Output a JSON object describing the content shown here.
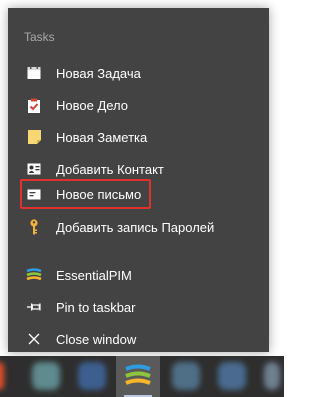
{
  "jumplist": {
    "section_title": "Tasks",
    "tasks": [
      {
        "label": "Новая Задача",
        "icon": "calendar-icon"
      },
      {
        "label": "Новое Дело",
        "icon": "clipboard-check-icon"
      },
      {
        "label": "Новая Заметка",
        "icon": "note-icon"
      },
      {
        "label": "Добавить Контакт",
        "icon": "contact-card-icon"
      },
      {
        "label": "Новое письмо",
        "icon": "email-icon",
        "highlighted": true
      },
      {
        "label": "Добавить запись Паролей",
        "icon": "key-icon"
      }
    ],
    "app_items": [
      {
        "label": "EssentialPIM",
        "icon": "essentialpim-logo-icon"
      },
      {
        "label": "Pin to taskbar",
        "icon": "pin-icon"
      },
      {
        "label": "Close window",
        "icon": "close-icon"
      }
    ]
  },
  "colors": {
    "menu_bg": "#434343",
    "highlight_border": "#e0312f",
    "taskbar_bg": "#2e2e2e"
  }
}
